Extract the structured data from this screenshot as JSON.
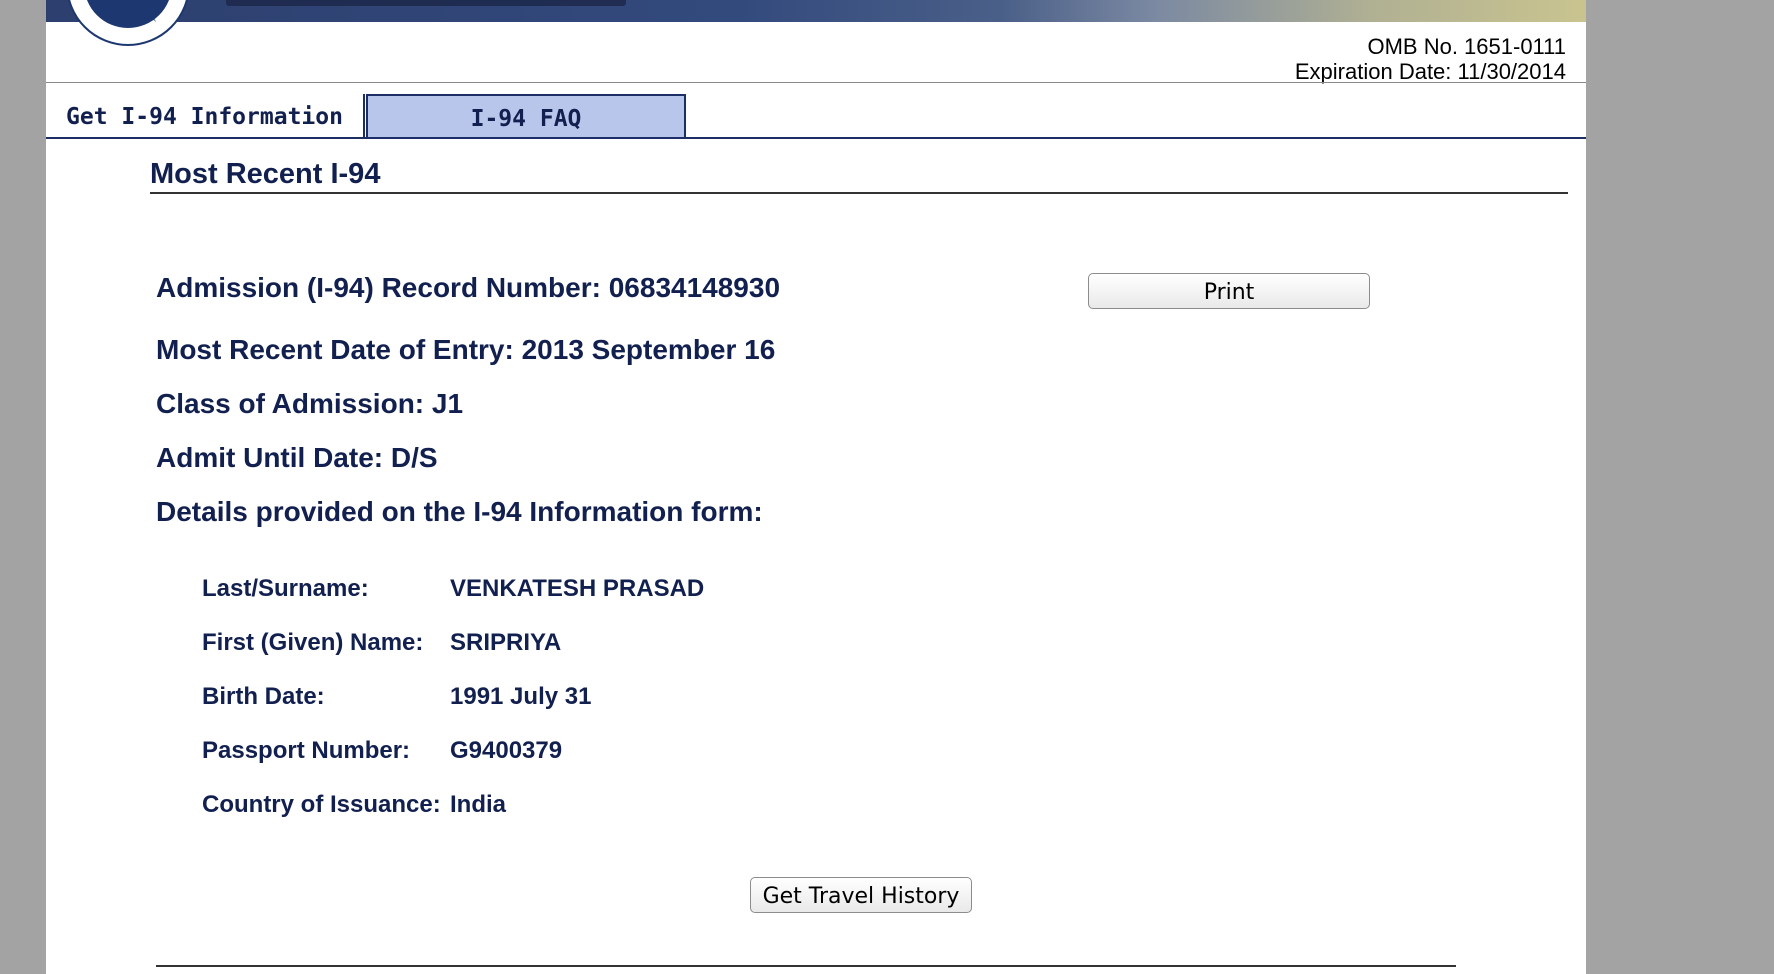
{
  "header": {
    "omb_number": "OMB No. 1651-0111",
    "expiration": "Expiration Date: 11/30/2014"
  },
  "tabs": [
    {
      "label": "Get I-94 Information",
      "active": true
    },
    {
      "label": "I-94 FAQ",
      "active": false
    }
  ],
  "section": {
    "title": "Most Recent I-94"
  },
  "record": {
    "admission_number": "Admission (I-94) Record Number: 06834148930",
    "date_of_entry": "Most Recent Date of Entry: 2013 September 16",
    "class_of_admission": "Class of Admission: J1",
    "admit_until": "Admit Until Date: D/S",
    "details_heading": "Details provided on the I-94 Information form:"
  },
  "details": [
    {
      "label": "Last/Surname:",
      "value": "VENKATESH PRASAD"
    },
    {
      "label": "First (Given) Name:",
      "value": "SRIPRIYA"
    },
    {
      "label": "Birth Date:",
      "value": "1991 July 31"
    },
    {
      "label": "Passport Number:",
      "value": "G9400379"
    },
    {
      "label": "Country of Issuance:",
      "value": "India"
    }
  ],
  "buttons": {
    "print": "Print",
    "travel_history": "Get Travel History"
  },
  "colors": {
    "heading_text": "#12204f",
    "tab_inactive_bg": "#b9c6ec",
    "page_bg": "#a3a3a3"
  }
}
